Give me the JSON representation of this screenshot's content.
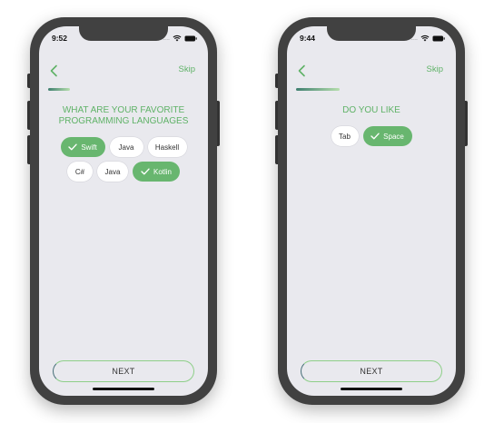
{
  "screens": [
    {
      "time": "9:52",
      "skip_label": "Skip",
      "question_lines": [
        "WHAT ARE YOUR FAVORITE",
        "PROGRAMMING LANGUAGES"
      ],
      "chip_rows": [
        [
          {
            "label": "Swift",
            "selected": true
          },
          {
            "label": "Java",
            "selected": false
          },
          {
            "label": "Haskell",
            "selected": false
          }
        ],
        [
          {
            "label": "C#",
            "selected": false
          },
          {
            "label": "Java",
            "selected": false
          },
          {
            "label": "Kotlin",
            "selected": true
          }
        ]
      ],
      "next_label": "NEXT",
      "progress": 0.2
    },
    {
      "time": "9:44",
      "skip_label": "Skip",
      "question_lines": [
        "DO YOU LIKE"
      ],
      "chip_rows": [
        [
          {
            "label": "Tab",
            "selected": false
          },
          {
            "label": "Space",
            "selected": true
          }
        ]
      ],
      "next_label": "NEXT",
      "progress": 0.3
    }
  ],
  "colors": {
    "accent": "#5fb267",
    "chip_selected": "#68b66f",
    "screen_bg": "#e9e9ee",
    "frame": "#414141"
  },
  "icons": {
    "back": "chevron-left-icon",
    "check": "checkmark-icon",
    "signal": "signal-dots-icon",
    "wifi": "wifi-icon",
    "battery": "battery-icon"
  }
}
